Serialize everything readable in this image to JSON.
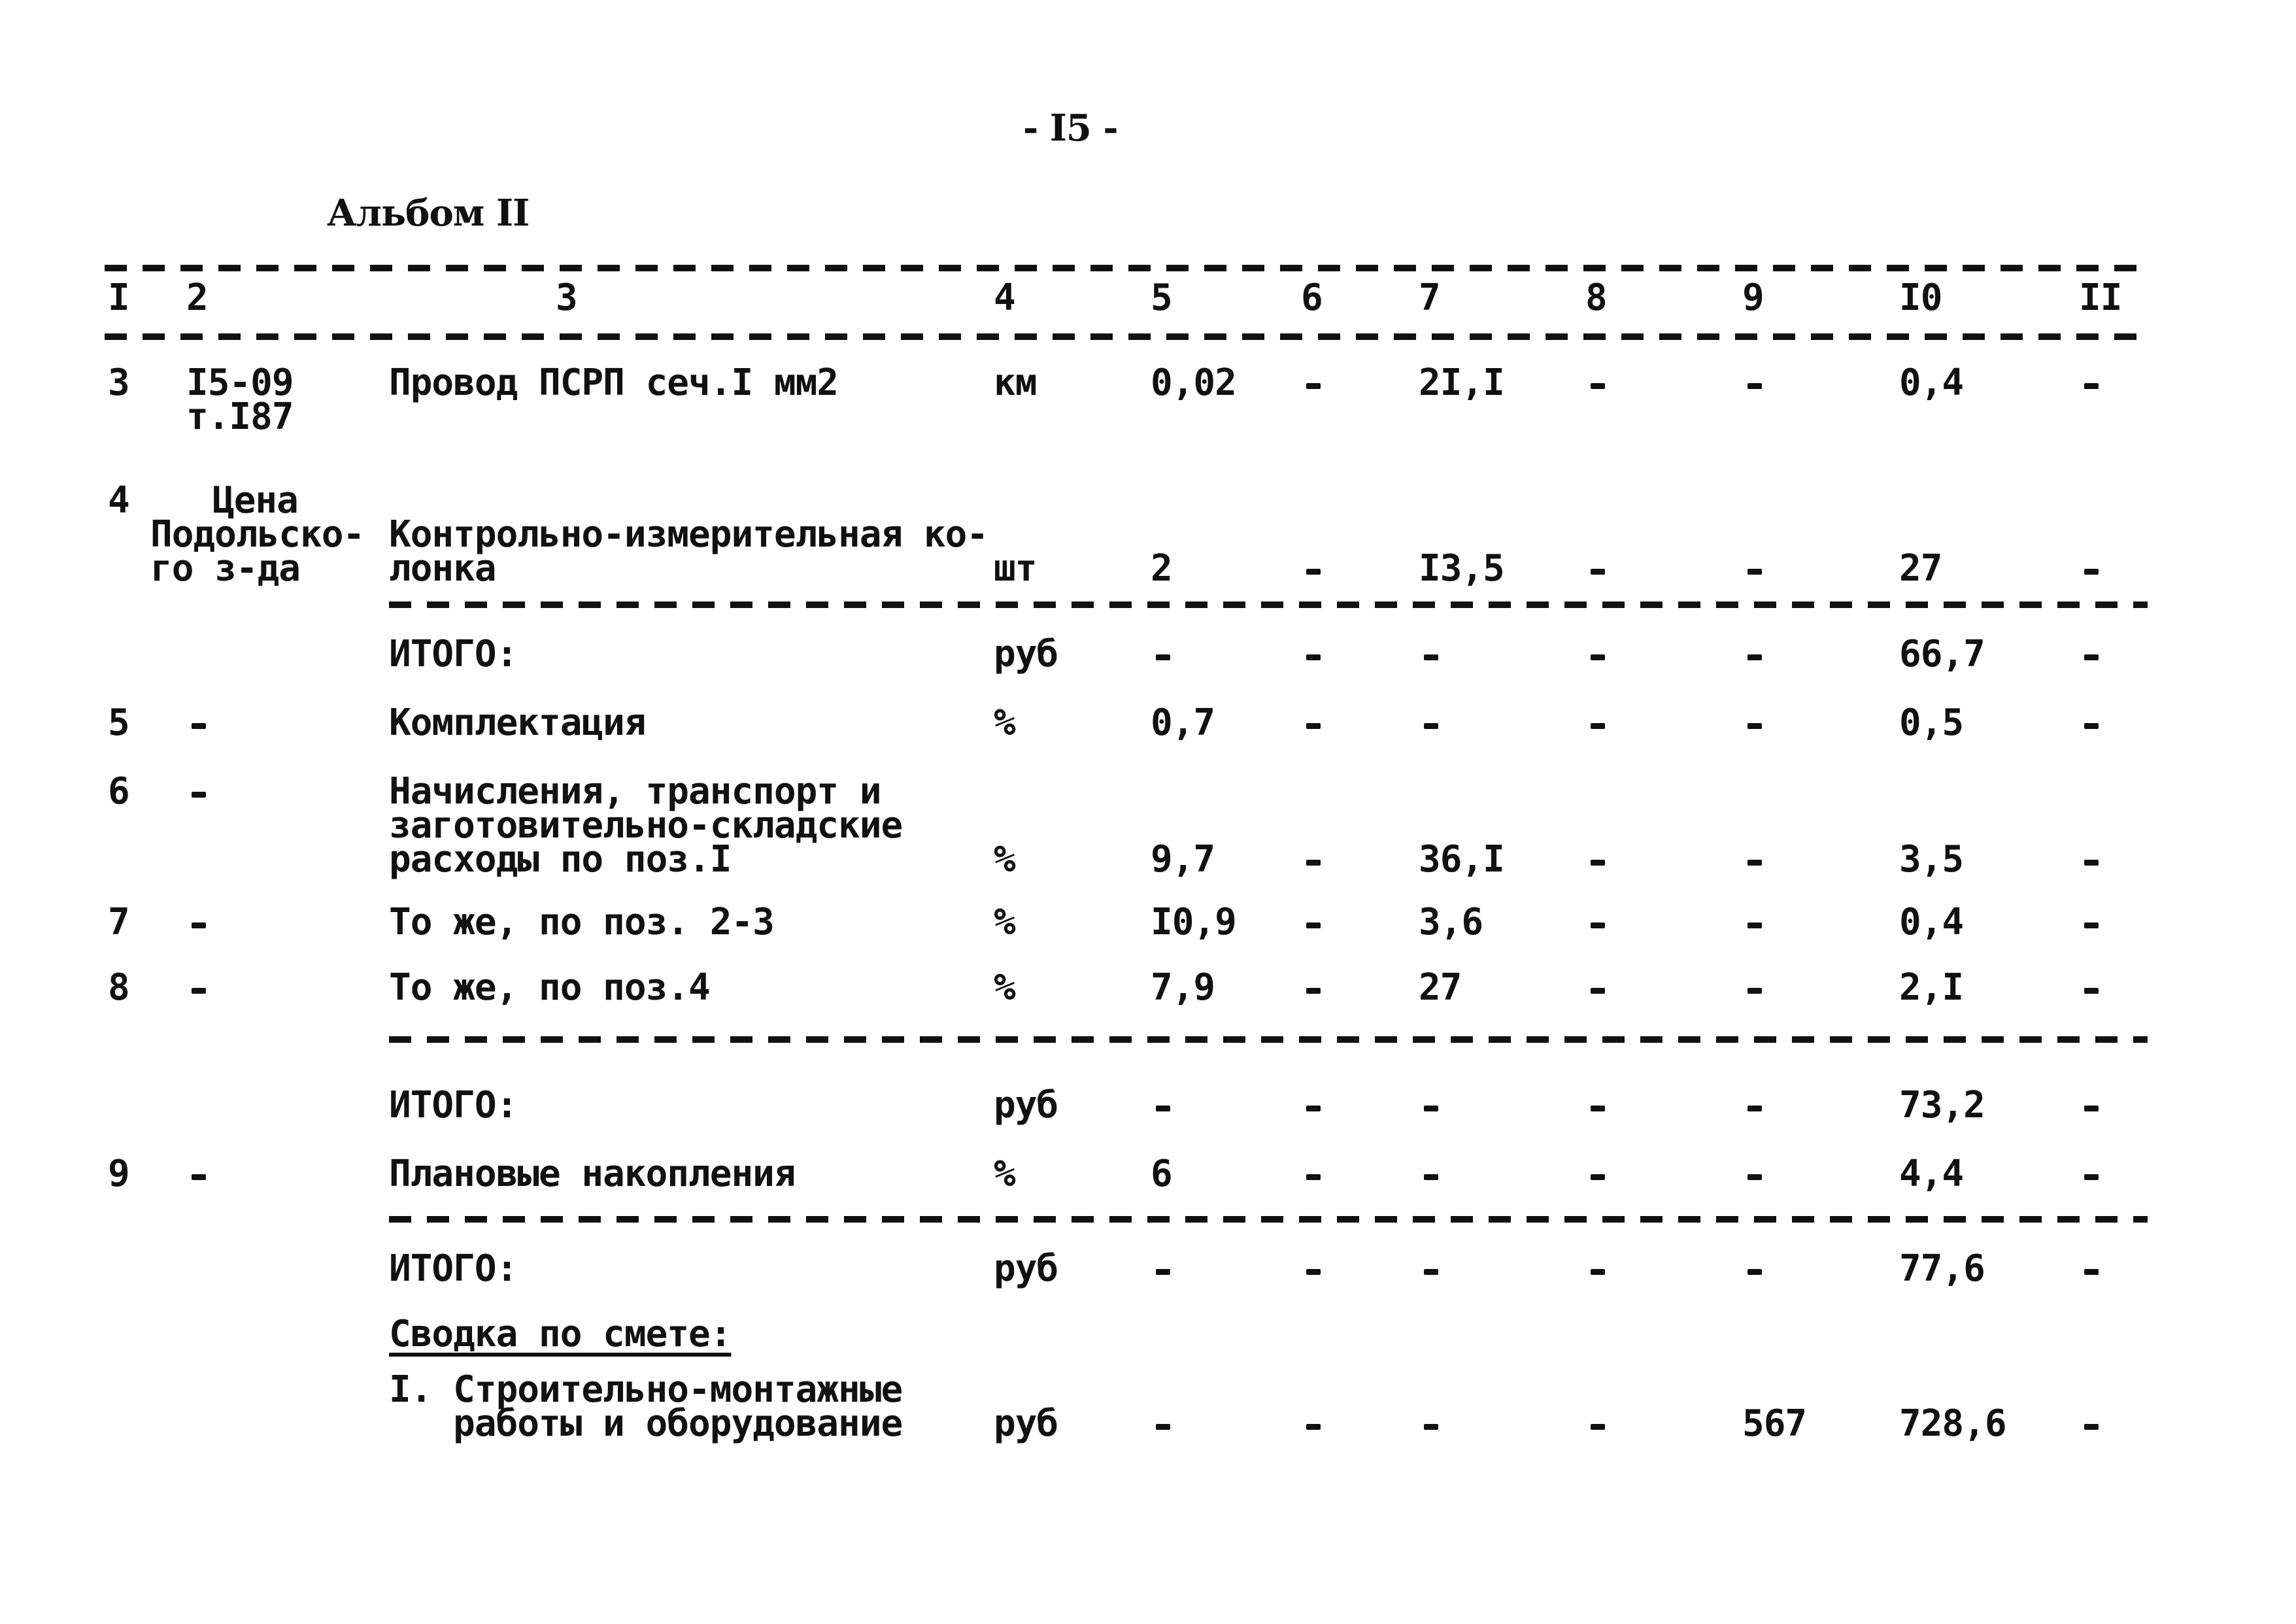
{
  "page_number": "- I5 -",
  "album": "Альбом II",
  "columns": [
    "I",
    "2",
    "3",
    "4",
    "5",
    "6",
    "7",
    "8",
    "9",
    "I0",
    "II"
  ],
  "rows": [
    {
      "n": "3",
      "code": [
        "I5-09",
        "т.I87"
      ],
      "name": [
        "Провод ПСРП сеч.I мм2"
      ],
      "unit": "км",
      "c5": "0,02",
      "c6": "-",
      "c7": "2I,I",
      "c8": "-",
      "c9": "-",
      "c10": "0,4",
      "c11": "-"
    },
    {
      "n": "4",
      "code": [
        "Цена",
        "Подольско-",
        "го з-да"
      ],
      "name": [
        "Контрольно-измерительная ко-",
        "лонка"
      ],
      "unit": "шт",
      "c5": "2",
      "c6": "-",
      "c7": "I3,5",
      "c8": "-",
      "c9": "-",
      "c10": "27",
      "c11": "-"
    },
    {
      "n": "",
      "code": [],
      "name": [
        "ИТОГО:"
      ],
      "unit": "руб",
      "c5": "-",
      "c6": "-",
      "c7": "-",
      "c8": "-",
      "c9": "-",
      "c10": "66,7",
      "c11": "-"
    },
    {
      "n": "5",
      "code": [
        "-"
      ],
      "name": [
        "Комплектация"
      ],
      "unit": "%",
      "c5": "0,7",
      "c6": "-",
      "c7": "-",
      "c8": "-",
      "c9": "-",
      "c10": "0,5",
      "c11": "-"
    },
    {
      "n": "6",
      "code": [
        "-"
      ],
      "name": [
        "Начисления, транспорт и",
        "заготовительно-складские",
        "расходы по поз.I"
      ],
      "unit": "%",
      "c5": "9,7",
      "c6": "-",
      "c7": "36,I",
      "c8": "-",
      "c9": "-",
      "c10": "3,5",
      "c11": "-"
    },
    {
      "n": "7",
      "code": [
        "-"
      ],
      "name": [
        "То же, по поз. 2-3"
      ],
      "unit": "%",
      "c5": "I0,9",
      "c6": "-",
      "c7": "3,6",
      "c8": "-",
      "c9": "-",
      "c10": "0,4",
      "c11": "-"
    },
    {
      "n": "8",
      "code": [
        "-"
      ],
      "name": [
        "То же, по поз.4"
      ],
      "unit": "%",
      "c5": "7,9",
      "c6": "-",
      "c7": "27",
      "c8": "-",
      "c9": "-",
      "c10": "2,I",
      "c11": "-"
    },
    {
      "n": "",
      "code": [],
      "name": [
        "ИТОГО:"
      ],
      "unit": "руб",
      "c5": "-",
      "c6": "-",
      "c7": "-",
      "c8": "-",
      "c9": "-",
      "c10": "73,2",
      "c11": "-"
    },
    {
      "n": "9",
      "code": [
        "-"
      ],
      "name": [
        "Плановые накопления"
      ],
      "unit": "%",
      "c5": "6",
      "c6": "-",
      "c7": "-",
      "c8": "-",
      "c9": "-",
      "c10": "4,4",
      "c11": "-"
    },
    {
      "n": "",
      "code": [],
      "name": [
        "ИТОГО:"
      ],
      "unit": "руб",
      "c5": "-",
      "c6": "-",
      "c7": "-",
      "c8": "-",
      "c9": "-",
      "c10": "77,6",
      "c11": "-"
    }
  ],
  "summary": {
    "heading": "Сводка по смете:",
    "item": {
      "name": [
        "I. Строительно-монтажные",
        "   работы и оборудование"
      ],
      "unit": "руб",
      "c5": "-",
      "c6": "-",
      "c7": "-",
      "c8": "-",
      "c9": "567",
      "c10": "728,6",
      "c11": "-"
    }
  }
}
